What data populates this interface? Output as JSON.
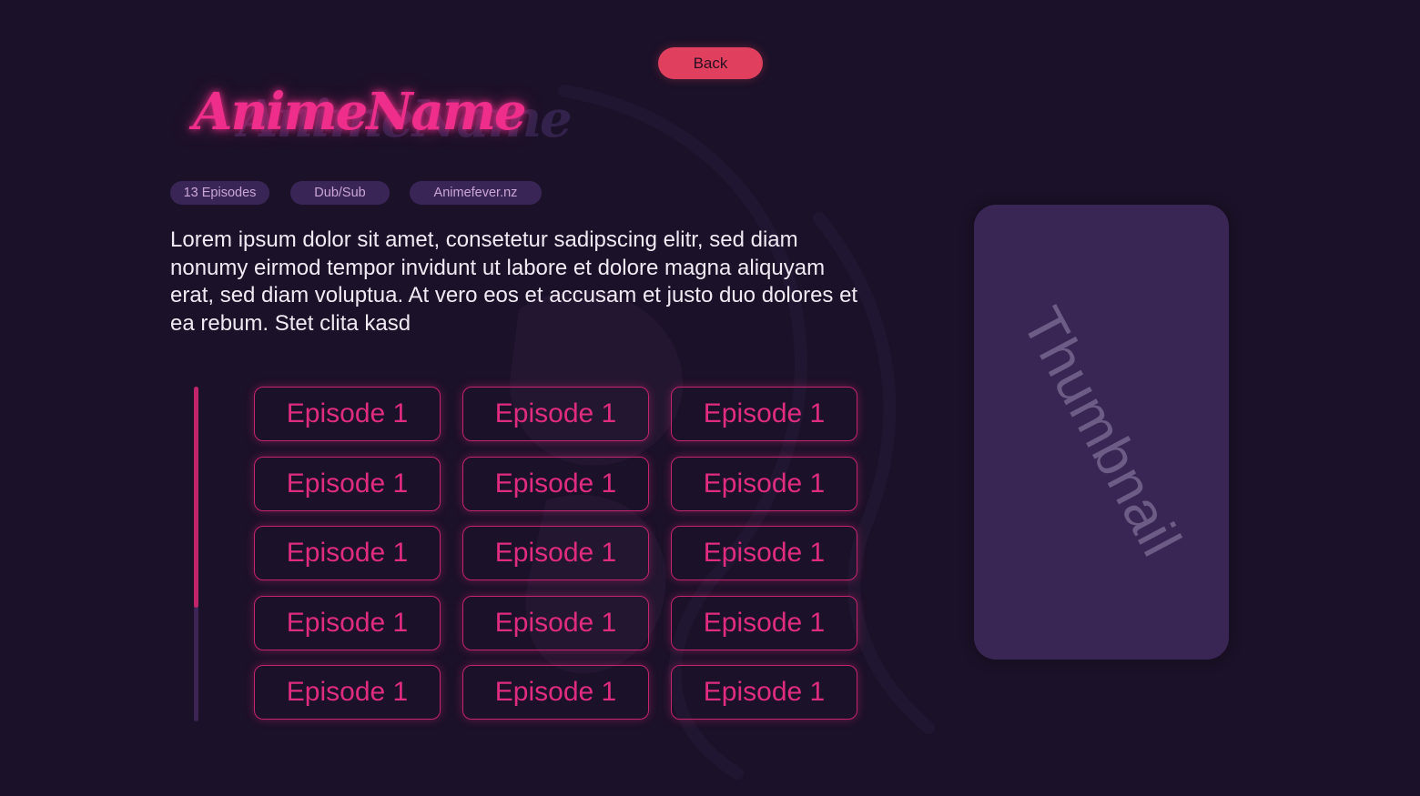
{
  "header": {
    "back_label": "Back"
  },
  "anime": {
    "title": "AnimeName",
    "tags": {
      "episodes": "13 Episodes",
      "audio": "Dub/Sub",
      "source": "Animefever.nz"
    },
    "description": "Lorem ipsum dolor sit amet, consetetur sadipscing elitr, sed diam nonumy eirmod tempor invidunt ut labore et dolore magna aliquyam erat, sed diam voluptua. At vero eos et accusam et justo duo dolores et ea rebum. Stet clita kasd"
  },
  "episodes": [
    {
      "label": "Episode 1"
    },
    {
      "label": "Episode 1"
    },
    {
      "label": "Episode 1"
    },
    {
      "label": "Episode 1"
    },
    {
      "label": "Episode 1"
    },
    {
      "label": "Episode 1"
    },
    {
      "label": "Episode 1"
    },
    {
      "label": "Episode 1"
    },
    {
      "label": "Episode 1"
    },
    {
      "label": "Episode 1"
    },
    {
      "label": "Episode 1"
    },
    {
      "label": "Episode 1"
    },
    {
      "label": "Episode 1"
    },
    {
      "label": "Episode 1"
    },
    {
      "label": "Episode 1"
    }
  ],
  "thumbnail": {
    "label": "Thumbnail"
  },
  "colors": {
    "background": "#1b1128",
    "accent_pink": "#e02c80",
    "back_button": "#e0405e",
    "tag_bg": "#3a2656",
    "thumbnail_bg": "#3a2654"
  }
}
